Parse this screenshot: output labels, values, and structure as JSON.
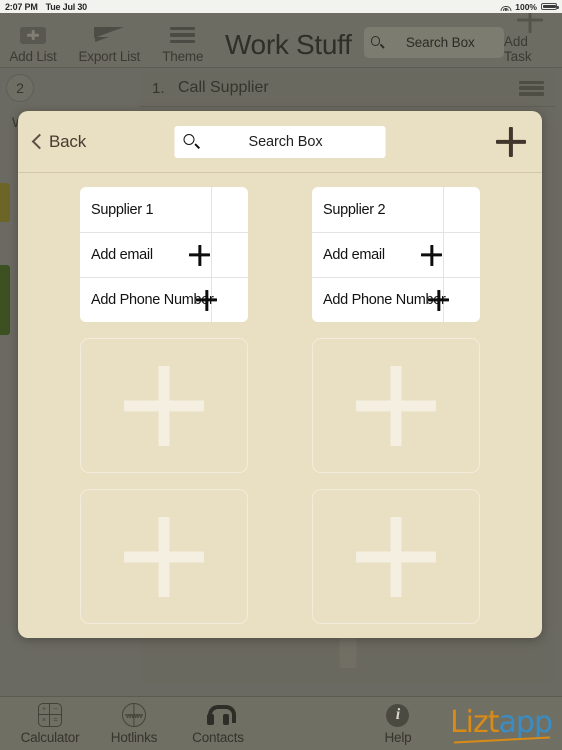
{
  "status_bar": {
    "time": "2:07 PM",
    "date": "Tue Jul 30",
    "battery_pct": "100%",
    "wifi_icon": "wifi-icon",
    "battery_icon": "battery-full-icon"
  },
  "toolbar": {
    "add_list_label": "Add List",
    "add_list_icon": "add-list-icon",
    "export_list_label": "Export List",
    "export_list_icon": "paper-plane-icon",
    "theme_label": "Theme",
    "theme_icon": "hamburger-lines-icon",
    "title": "Work Stuff",
    "search_icon": "search-icon",
    "search_placeholder": "Search Box",
    "search_value": "",
    "add_task_label": "Add Task",
    "add_task_icon": "plus-icon"
  },
  "background": {
    "list_count_badge": "2",
    "list_name": "Work Stuff",
    "task_number": "1.",
    "task_title": "Call Supplier",
    "task_menu_icon": "hamburger-lines-icon",
    "add_placeholder_icon": "plus-icon"
  },
  "modal": {
    "back_label": "Back",
    "back_icon": "chevron-left-icon",
    "search_icon": "search-icon",
    "search_placeholder": "Search Box",
    "search_value": "",
    "add_icon": "plus-icon",
    "contacts": [
      {
        "name": "Supplier 1",
        "rows": [
          {
            "label": "Add email",
            "icon": "plus-icon"
          },
          {
            "label": "Add Phone Number",
            "icon": "plus-icon"
          }
        ]
      },
      {
        "name": "Supplier 2",
        "rows": [
          {
            "label": "Add email",
            "icon": "plus-icon"
          },
          {
            "label": "Add Phone Number",
            "icon": "plus-icon"
          }
        ]
      }
    ],
    "empty_slots": [
      {
        "icon": "plus-icon"
      },
      {
        "icon": "plus-icon"
      },
      {
        "icon": "plus-icon"
      },
      {
        "icon": "plus-icon"
      }
    ]
  },
  "tab_bar": {
    "tabs": [
      {
        "label": "Calculator",
        "icon": "calculator-icon"
      },
      {
        "label": "Hotlinks",
        "icon": "globe-www-icon"
      },
      {
        "label": "Contacts",
        "icon": "headset-icon"
      },
      {
        "label": "Help",
        "icon": "info-icon"
      }
    ],
    "brand_part_1": "Lizt",
    "brand_part_2": "app"
  },
  "colors": {
    "modal_bg": "#E9DFC2",
    "card_bg": "#FFFFFF",
    "chrome": "#706F64",
    "brand_orange": "#D88B16",
    "brand_blue": "#3A8DC4",
    "list_chip_olive": "#6D6527",
    "list_chip_green": "#3C5022"
  }
}
